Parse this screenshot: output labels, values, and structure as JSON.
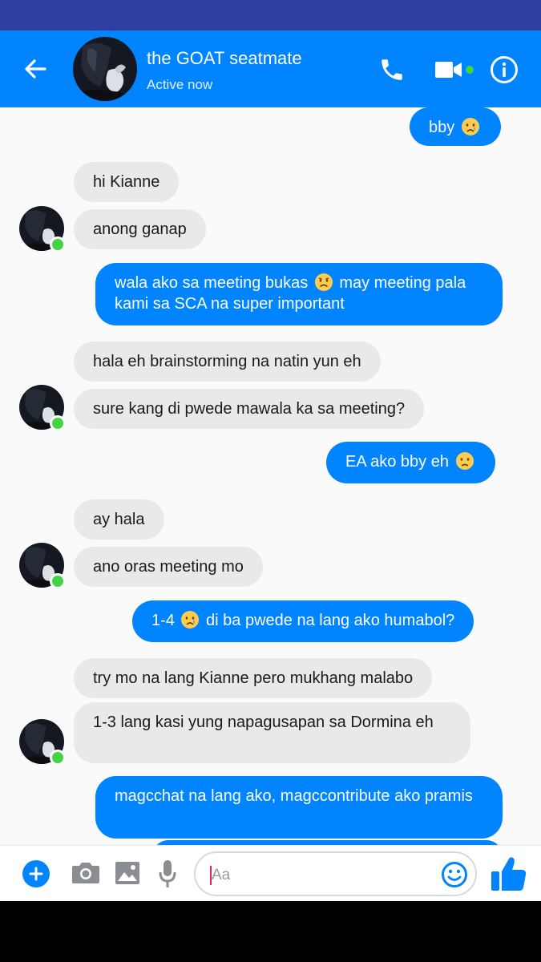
{
  "header": {
    "contact_name": "the GOAT seatmate",
    "status": "Active now",
    "accent_color": "#0084ff",
    "online_color": "#42d442"
  },
  "messages": [
    {
      "dir": "out",
      "text": "bby",
      "emoji": "crying-face"
    },
    {
      "dir": "in",
      "text": "hi Kianne"
    },
    {
      "dir": "in",
      "text": "anong ganap"
    },
    {
      "dir": "out",
      "text_parts": [
        "wala ako sa meeting bukas",
        "may meeting pala kami sa SCA na super important"
      ],
      "emoji": "sad-face"
    },
    {
      "dir": "in",
      "text": "hala eh brainstorming na natin yun eh"
    },
    {
      "dir": "in",
      "text": "sure kang di pwede mawala ka sa meeting?"
    },
    {
      "dir": "out",
      "text": "EA ako bby eh",
      "emoji": "frowning-face"
    },
    {
      "dir": "in",
      "text": "ay hala"
    },
    {
      "dir": "in",
      "text": "ano oras meeting mo"
    },
    {
      "dir": "out",
      "text_parts": [
        "1-4",
        "di ba pwede na lang ako humabol?"
      ],
      "emoji": "crying-face"
    },
    {
      "dir": "in",
      "text": "try mo na lang Kianne pero mukhang malabo"
    },
    {
      "dir": "in",
      "text": "1-3 lang kasi yung napagusapan sa Dormina eh"
    },
    {
      "dir": "out",
      "text": "magcchat na lang ako, magccontribute ako pramis"
    }
  ],
  "composer": {
    "placeholder": "Aa"
  }
}
